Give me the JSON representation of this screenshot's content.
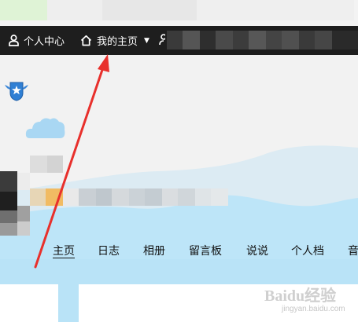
{
  "topnav": {
    "profile_label": "个人中心",
    "home_label": "我的主页"
  },
  "tabs": [
    {
      "label": "主页",
      "active": true
    },
    {
      "label": "日志",
      "active": false
    },
    {
      "label": "相册",
      "active": false
    },
    {
      "label": "留言板",
      "active": false
    },
    {
      "label": "说说",
      "active": false
    },
    {
      "label": "个人档",
      "active": false
    },
    {
      "label": "音",
      "active": false
    }
  ],
  "watermark": {
    "line1": "Baidu经验",
    "line2": "jingyan.baidu.com"
  },
  "colors": {
    "nav_bg": "#1e1e1e",
    "sky_blue": "#b9e3f7",
    "arrow_red": "#e8302c"
  }
}
